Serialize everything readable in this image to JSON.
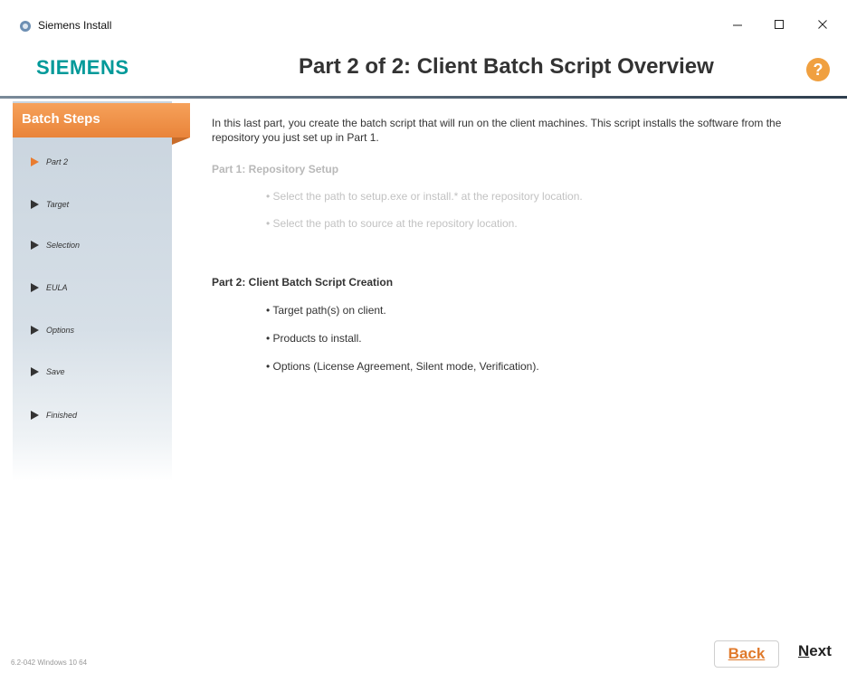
{
  "window": {
    "title": "Siemens Install",
    "minimize_glyph": "–",
    "maximize_glyph": "☐",
    "close_glyph": "✕"
  },
  "header": {
    "brand": "SIEMENS",
    "title": "Part 2 of 2: Client Batch Script Overview",
    "help_glyph": "?"
  },
  "sidebar": {
    "title": "Batch Steps",
    "items": [
      {
        "label": "Part 2",
        "active": true
      },
      {
        "label": "Target",
        "active": false
      },
      {
        "label": "Selection",
        "active": false
      },
      {
        "label": "EULA",
        "active": false
      },
      {
        "label": "Options",
        "active": false
      },
      {
        "label": "Save",
        "active": false
      },
      {
        "label": "Finished",
        "active": false
      }
    ],
    "version": "6.2-042  Windows 10 64"
  },
  "main": {
    "intro": "In this last part, you create the batch script that will run on the client machines. This script installs the software from the repository you just set up in Part 1.",
    "part1": {
      "heading": "Part 1: Repository Setup",
      "bullets": [
        "• Select the path to setup.exe or install.* at the repository location.",
        "• Select the path to source at the repository location."
      ]
    },
    "part2": {
      "heading": "Part 2: Client Batch Script Creation",
      "bullets": [
        "• Target path(s) on client.",
        "• Products to install.",
        "• Options (License Agreement, Silent mode, Verification)."
      ]
    }
  },
  "footer": {
    "back_label": "Back",
    "next_first": "N",
    "next_rest": "ext"
  },
  "colors": {
    "brand": "#009999",
    "accent_orange": "#e97c30",
    "muted_text": "#c2c2c2"
  }
}
